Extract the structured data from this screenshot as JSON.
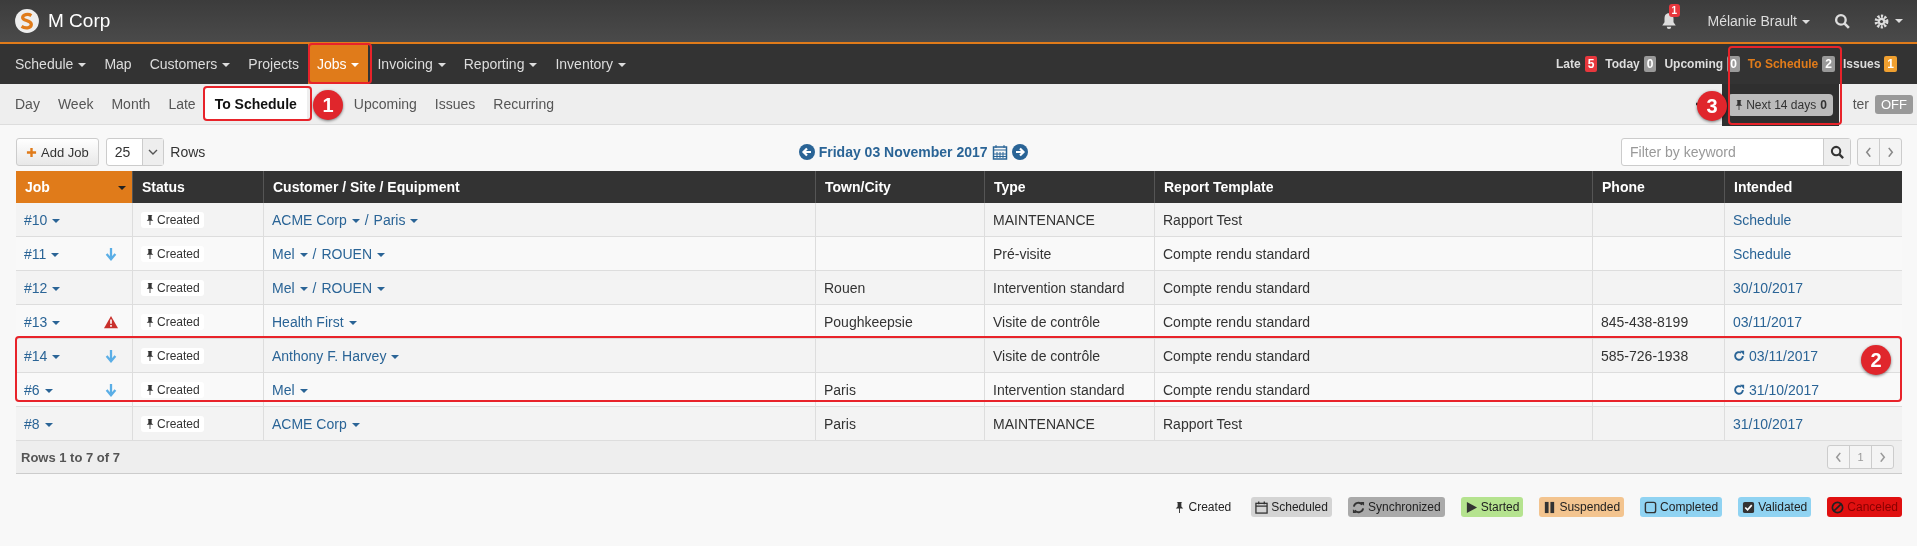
{
  "app": {
    "title": "M Corp",
    "notifications": "1",
    "user": "Mélanie Brault"
  },
  "main_nav": [
    {
      "label": "Schedule",
      "dropdown": true,
      "selected": false
    },
    {
      "label": "Map",
      "dropdown": false,
      "selected": false
    },
    {
      "label": "Customers",
      "dropdown": true,
      "selected": false
    },
    {
      "label": "Projects",
      "dropdown": false,
      "selected": false
    },
    {
      "label": "Jobs",
      "dropdown": true,
      "selected": true
    },
    {
      "label": "Invoicing",
      "dropdown": true,
      "selected": false
    },
    {
      "label": "Reporting",
      "dropdown": true,
      "selected": false
    },
    {
      "label": "Inventory",
      "dropdown": true,
      "selected": false
    }
  ],
  "counters": [
    {
      "label": "Late",
      "count": "5",
      "color": "#e8373d",
      "selected": false
    },
    {
      "label": "Today",
      "count": "0",
      "color": "#999999",
      "selected": false
    },
    {
      "label": "Upcoming",
      "count": "0",
      "color": "#999999",
      "selected": false
    },
    {
      "label": "To Schedule",
      "count": "2",
      "color": "#999999",
      "selected": true
    },
    {
      "label": "Issues",
      "count": "1",
      "color": "#f0a030",
      "selected": false
    }
  ],
  "counter_dropdown": {
    "label": "Next 14 days",
    "count": "0"
  },
  "sub_nav": [
    {
      "label": "Day",
      "selected": false
    },
    {
      "label": "Week",
      "selected": false
    },
    {
      "label": "Month",
      "selected": false
    },
    {
      "label": "Late",
      "selected": false
    },
    {
      "label": "To Schedule",
      "selected": true
    },
    {
      "label": "Upcoming",
      "selected": false
    },
    {
      "label": "Issues",
      "selected": false
    },
    {
      "label": "Recurring",
      "selected": false
    }
  ],
  "filter_toggle": {
    "label": "ter",
    "state": "OFF",
    "on": false
  },
  "toolbar": {
    "add_button": "Add Job",
    "rows_per_page": "25",
    "rows_label": "Rows",
    "date": "Friday 03 November 2017",
    "search_placeholder": "Filter by keyword"
  },
  "table": {
    "columns": [
      {
        "label": "Job",
        "sorted": true
      },
      {
        "label": "Status",
        "sorted": false
      },
      {
        "label": "Customer / Site / Equipment",
        "sorted": false
      },
      {
        "label": "Town/City",
        "sorted": false
      },
      {
        "label": "Type",
        "sorted": false
      },
      {
        "label": "Report Template",
        "sorted": false
      },
      {
        "label": "Phone",
        "sorted": false
      },
      {
        "label": "Intended",
        "sorted": false
      }
    ],
    "rows": [
      {
        "job": "#10",
        "arrow_down": false,
        "warning": false,
        "status": "Created",
        "customer": [
          {
            "kind": "link",
            "text": "ACME Corp"
          },
          {
            "kind": "separator",
            "text": "/"
          },
          {
            "kind": "link",
            "text": "Paris"
          }
        ],
        "town": "",
        "type": "MAINTENANCE",
        "template": "Rapport Test",
        "phone": "",
        "intended": "Schedule",
        "recurring": false
      },
      {
        "job": "#11",
        "arrow_down": true,
        "warning": false,
        "status": "Created",
        "customer": [
          {
            "kind": "link",
            "text": "Mel"
          },
          {
            "kind": "separator",
            "text": "/"
          },
          {
            "kind": "link",
            "text": "ROUEN"
          }
        ],
        "town": "",
        "type": "Pré-visite",
        "template": "Compte rendu standard",
        "phone": "",
        "intended": "Schedule",
        "recurring": false
      },
      {
        "job": "#12",
        "arrow_down": false,
        "warning": false,
        "status": "Created",
        "customer": [
          {
            "kind": "link",
            "text": "Mel"
          },
          {
            "kind": "separator",
            "text": "/"
          },
          {
            "kind": "link",
            "text": "ROUEN"
          }
        ],
        "town": "Rouen",
        "type": "Intervention standard",
        "template": "Compte rendu standard",
        "phone": "",
        "intended": "30/10/2017",
        "recurring": false
      },
      {
        "job": "#13",
        "arrow_down": false,
        "warning": true,
        "status": "Created",
        "customer": [
          {
            "kind": "link",
            "text": "Health First"
          }
        ],
        "town": "Poughkeepsie",
        "type": "Visite de contrôle",
        "template": "Compte rendu standard",
        "phone": "845-438-8199",
        "intended": "03/11/2017",
        "recurring": false
      },
      {
        "job": "#14",
        "arrow_down": true,
        "warning": false,
        "status": "Created",
        "customer": [
          {
            "kind": "link",
            "text": "Anthony F. Harvey"
          }
        ],
        "town": "",
        "type": "Visite de contrôle",
        "template": "Compte rendu standard",
        "phone": "585-726-1938",
        "intended": "03/11/2017",
        "recurring": true
      },
      {
        "job": "#6",
        "arrow_down": true,
        "warning": false,
        "status": "Created",
        "customer": [
          {
            "kind": "link",
            "text": "Mel"
          }
        ],
        "town": "Paris",
        "type": "Intervention standard",
        "template": "Compte rendu standard",
        "phone": "",
        "intended": "31/10/2017",
        "recurring": true
      },
      {
        "job": "#8",
        "arrow_down": false,
        "warning": false,
        "status": "Created",
        "customer": [
          {
            "kind": "link",
            "text": "ACME Corp"
          }
        ],
        "town": "Paris",
        "type": "MAINTENANCE",
        "template": "Rapport Test",
        "phone": "",
        "intended": "31/10/2017",
        "recurring": false
      }
    ],
    "footer": "Rows 1 to 7 of 7",
    "page": "1"
  },
  "legend": [
    {
      "kind": "pin",
      "label": "Created",
      "color": "#f8f8f8"
    },
    {
      "kind": "calendar",
      "label": "Scheduled",
      "color": "#d4d4d4"
    },
    {
      "kind": "sync",
      "label": "Synchronized",
      "color": "#aaaaaa"
    },
    {
      "kind": "play",
      "label": "Started",
      "color": "#b5e38f"
    },
    {
      "kind": "pause",
      "label": "Suspended",
      "color": "#f3c48f"
    },
    {
      "kind": "square",
      "label": "Completed",
      "color": "#90d3f2"
    },
    {
      "kind": "check",
      "label": "Validated",
      "color": "#90d3f2"
    },
    {
      "kind": "ban",
      "label": "Canceled",
      "color": "#e01010"
    }
  ],
  "callouts": [
    {
      "number": "1"
    },
    {
      "number": "2"
    },
    {
      "number": "3"
    }
  ]
}
